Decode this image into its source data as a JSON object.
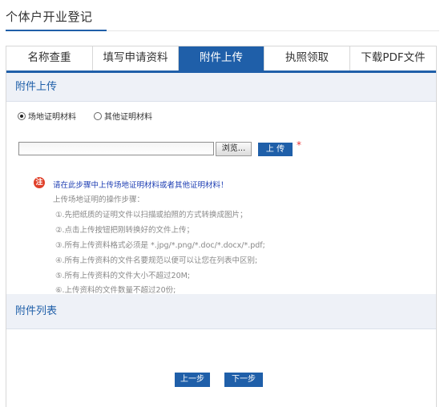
{
  "page": {
    "title": "个体户开业登记"
  },
  "tabs": [
    {
      "label": "名称查重"
    },
    {
      "label": "填写申请资料"
    },
    {
      "label": "附件上传"
    },
    {
      "label": "执照领取"
    },
    {
      "label": "下载PDF文件"
    }
  ],
  "active_tab_index": 2,
  "upload_section": {
    "heading": "附件上传",
    "radio_options": [
      {
        "label": "场地证明材料",
        "checked": true
      },
      {
        "label": "其他证明材料",
        "checked": false
      }
    ],
    "browse_label": "浏览...",
    "upload_label": "上 传",
    "required_mark": "*",
    "note": {
      "icon_text": "注",
      "headline": "请在此步骤中上传场地证明材料或者其他证明材料！",
      "steps_title": "上传场地证明的操作步骤：",
      "steps": [
        "①.先把纸质的证明文件以扫描或拍照的方式转换成图片；",
        "②.点击上传按钮把刚转换好的文件上传；",
        "③.所有上传资料格式必须是 *.jpg/*.png/*.doc/*.docx/*.pdf;",
        "④.所有上传资料的文件名要规范以便可以让您在列表中区别;",
        "⑤.所有上传资料的文件大小不超过20M;",
        "⑥.上传资料的文件数量不超过20份;"
      ]
    }
  },
  "list_section": {
    "heading": "附件列表"
  },
  "footer": {
    "prev_label": "上一步",
    "next_label": "下一步"
  },
  "colors": {
    "primary": "#1f5fa9",
    "alert": "#e0402a",
    "note_text": "#1f3fb3",
    "muted_text": "#888888"
  }
}
